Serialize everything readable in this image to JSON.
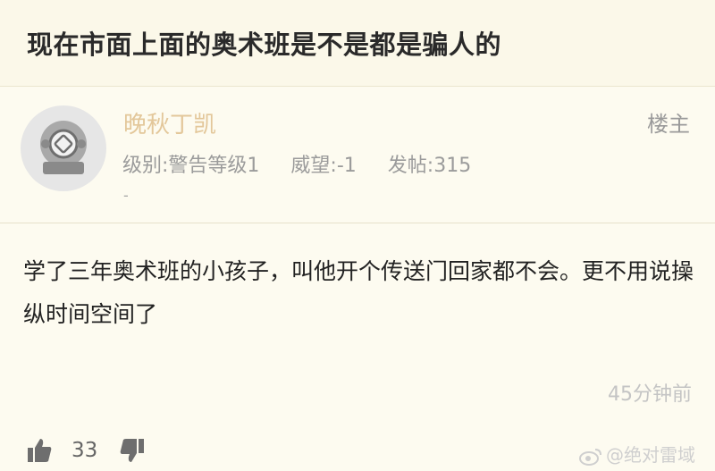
{
  "thread": {
    "title": "现在市面上面的奥术班是不是都是骗人的"
  },
  "post": {
    "author": {
      "name": "晚秋丁凯",
      "level": "级别:警告等级1",
      "prestige": "威望:-1",
      "posts": "发帖:315",
      "extra": "-"
    },
    "floor_label": "楼主",
    "content": "学了三年奥术班的小孩子，叫他开个传送门回家都不会。更不用说操纵时间空间了",
    "timestamp": "45分钟前"
  },
  "actions": {
    "like_count": "33"
  },
  "watermark": {
    "text": "@绝对雷域"
  },
  "colors": {
    "page_bg": "#fdfbf0",
    "username": "#e3c79a",
    "meta_gray": "#9b9b9b"
  }
}
